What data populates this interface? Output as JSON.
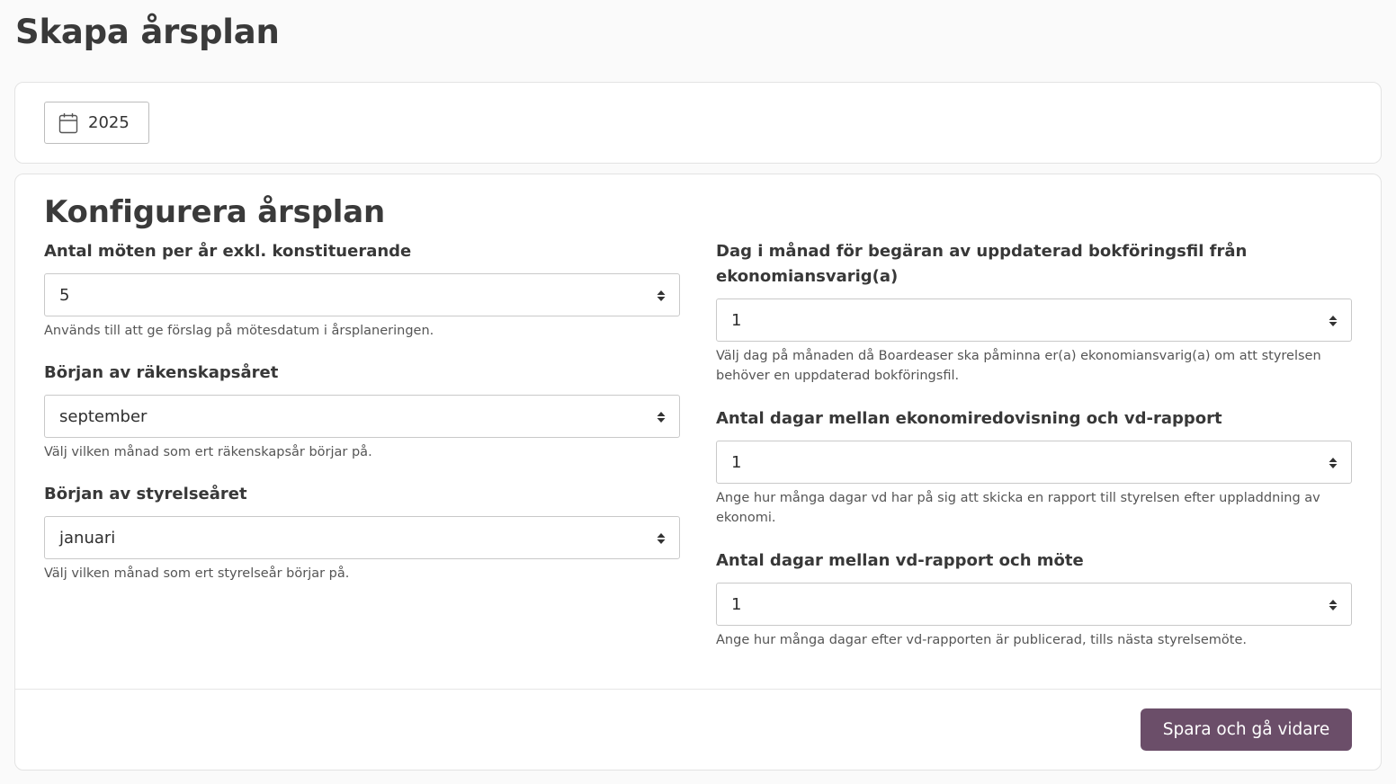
{
  "page": {
    "title": "Skapa årsplan"
  },
  "year_picker": {
    "icon": "calendar-icon",
    "value": "2025"
  },
  "config": {
    "title": "Konfigurera årsplan",
    "left_fields": [
      {
        "label": "Antal möten per år exkl. konstituerande",
        "value": "5",
        "help": "Används till att ge förslag på mötesdatum i årsplaneringen."
      },
      {
        "label": "Början av räkenskapsåret",
        "value": "september",
        "help": "Välj vilken månad som ert räkenskapsår börjar på."
      },
      {
        "label": "Början av styrelseåret",
        "value": "januari",
        "help": "Välj vilken månad som ert styrelseår börjar på."
      }
    ],
    "right_fields": [
      {
        "label": "Dag i månad för begäran av uppdaterad bokföringsfil från ekonomiansvarig(a)",
        "value": "1",
        "help": "Välj dag på månaden då Boardeaser ska påminna er(a) ekonomiansvarig(a) om att styrelsen behöver en uppdaterad bokföringsfil."
      },
      {
        "label": "Antal dagar mellan ekonomiredovisning och vd-rapport",
        "value": "1",
        "help": "Ange hur många dagar vd har på sig att skicka en rapport till styrelsen efter uppladdning av ekonomi."
      },
      {
        "label": "Antal dagar mellan vd-rapport och möte",
        "value": "1",
        "help": "Ange hur många dagar efter vd-rapporten är publicerad, tills nästa styrelsemöte."
      }
    ],
    "save_label": "Spara och gå vidare"
  },
  "colors": {
    "background": "#fafafa",
    "card": "#ffffff",
    "primary_button": "#6b4e69",
    "text": "#3a3a3a"
  }
}
